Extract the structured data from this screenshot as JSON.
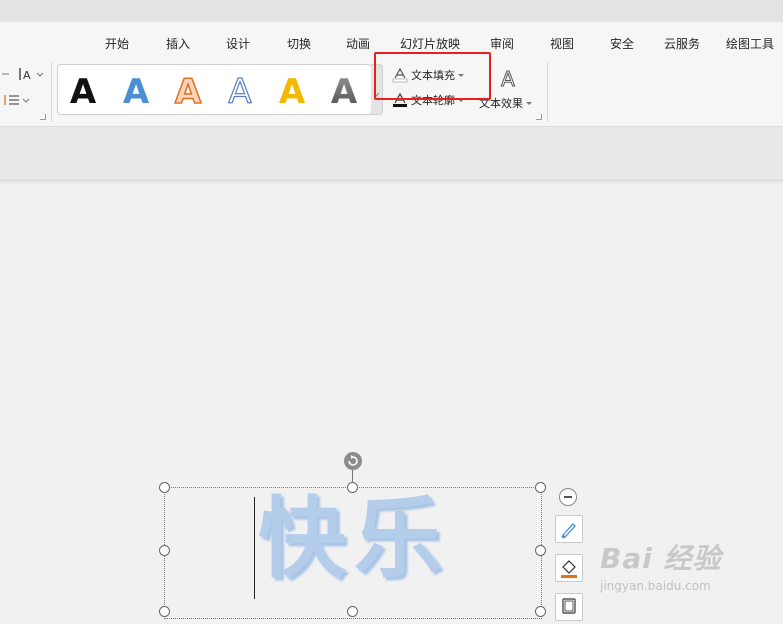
{
  "menu": {
    "tabs": [
      {
        "label": "开始"
      },
      {
        "label": "插入"
      },
      {
        "label": "设计"
      },
      {
        "label": "切换"
      },
      {
        "label": "动画"
      },
      {
        "label": "幻灯片放映"
      },
      {
        "label": "审阅"
      },
      {
        "label": "视图"
      },
      {
        "label": "安全"
      },
      {
        "label": "云服务"
      },
      {
        "label": "绘图工具"
      }
    ]
  },
  "ribbon": {
    "art_styles": [
      {
        "glyph": "A",
        "style": "black-solid"
      },
      {
        "glyph": "A",
        "style": "blue-solid"
      },
      {
        "glyph": "A",
        "style": "orange-outline"
      },
      {
        "glyph": "A",
        "style": "blue-outline"
      },
      {
        "glyph": "A",
        "style": "gold-solid"
      },
      {
        "glyph": "A",
        "style": "gray-gradient"
      }
    ],
    "text_fill_label": "文本填充",
    "text_outline_label": "文本轮廓",
    "text_effect_label": "文本效果"
  },
  "slide": {
    "text": "快乐"
  },
  "watermark": {
    "brand": "Bai 经验",
    "url": "jingyan.baidu.com"
  },
  "colors": {
    "highlight": "#e8211f",
    "text_fill": "#b3cdea",
    "accent_orange": "#e2731e"
  }
}
